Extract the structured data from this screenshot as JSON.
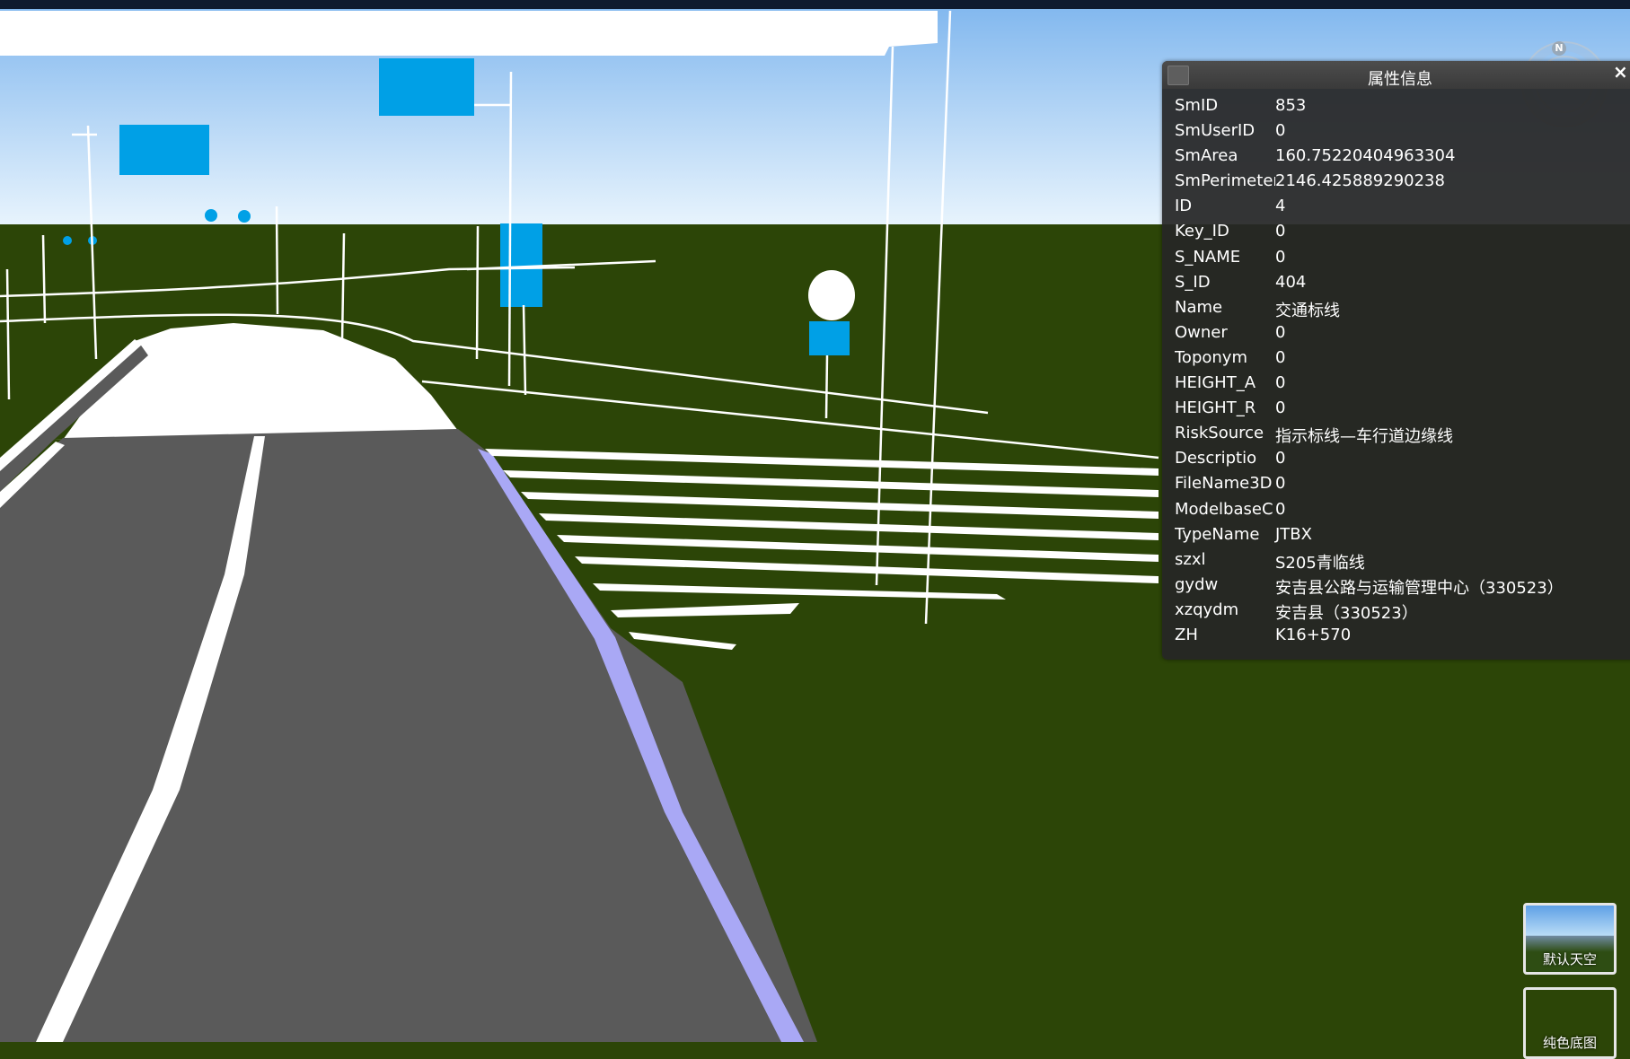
{
  "panel": {
    "title": "属性信息",
    "rows": [
      {
        "key": "SmID",
        "value": "853"
      },
      {
        "key": "SmUserID",
        "value": "0"
      },
      {
        "key": "SmArea",
        "value": "160.75220404963304"
      },
      {
        "key": "SmPerimeter",
        "value": "2146.425889290238"
      },
      {
        "key": "ID",
        "value": "4"
      },
      {
        "key": "Key_ID",
        "value": "0"
      },
      {
        "key": "S_NAME",
        "value": "0"
      },
      {
        "key": "S_ID",
        "value": "404"
      },
      {
        "key": "Name",
        "value": "交通标线"
      },
      {
        "key": "Owner",
        "value": "0"
      },
      {
        "key": "Toponym",
        "value": "0"
      },
      {
        "key": "HEIGHT_A",
        "value": "0"
      },
      {
        "key": "HEIGHT_R",
        "value": "0"
      },
      {
        "key": "RiskSource",
        "value": "指示标线—车行道边缘线"
      },
      {
        "key": "Descriptio",
        "value": "0"
      },
      {
        "key": "FileName3D",
        "value": "0"
      },
      {
        "key": "ModelbaseC",
        "value": "0"
      },
      {
        "key": "TypeName",
        "value": "JTBX"
      },
      {
        "key": "szxl",
        "value": "S205青临线"
      },
      {
        "key": "gydw",
        "value": "安吉县公路与运输管理中心（330523）"
      },
      {
        "key": "xzqydm",
        "value": "安吉县（330523）"
      },
      {
        "key": "ZH",
        "value": "K16+570"
      }
    ]
  },
  "close_label": "×",
  "compass": {
    "north_label": "N"
  },
  "basemaps": [
    {
      "label": "默认天空"
    },
    {
      "label": "纯色底图"
    }
  ],
  "colors": {
    "sky_top": "#7fb6ee",
    "sky_bottom": "#e8f4fd",
    "ground": "#2c4507",
    "road": "#5a5a5a",
    "road_edge_line": "#a9a8f5",
    "sign_blue": "#00a0e6",
    "panel_bg": "#262626"
  }
}
